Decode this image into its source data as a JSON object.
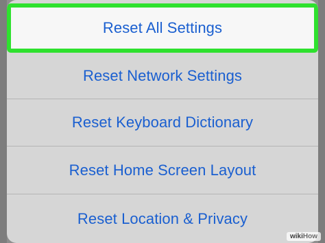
{
  "actions": [
    {
      "label": "Reset All Settings"
    },
    {
      "label": "Reset Network Settings"
    },
    {
      "label": "Reset Keyboard Dictionary"
    },
    {
      "label": "Reset Home Screen Layout"
    },
    {
      "label": "Reset Location & Privacy"
    }
  ],
  "highlight_color": "#2ee12e",
  "accent_color": "#1a5fd0",
  "watermark": {
    "left": "wiki",
    "right": "How"
  }
}
